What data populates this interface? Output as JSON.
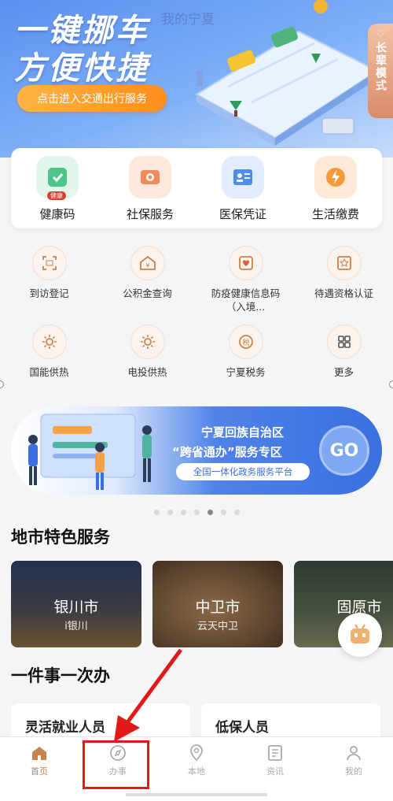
{
  "hero": {
    "title_line1": "一键挪车",
    "title_line2": "方便快捷",
    "watermark": "我的宁夏",
    "cta_label": "点击进入交通出行服务",
    "elder_mode_label": "长辈模式"
  },
  "main_services": [
    {
      "label": "健康码",
      "icon": "health-code-icon",
      "color": "#4cc48a",
      "badge": "健康"
    },
    {
      "label": "社保服务",
      "icon": "social-security-icon",
      "color": "#f08a5d"
    },
    {
      "label": "医保凭证",
      "icon": "medical-insurance-icon",
      "color": "#4b8ef0"
    },
    {
      "label": "生活缴费",
      "icon": "utility-payment-icon",
      "color": "#f59a3a"
    }
  ],
  "grid_services": [
    {
      "label": "到访登记",
      "icon": "scan-register-icon"
    },
    {
      "label": "公积金查询",
      "icon": "housing-fund-icon"
    },
    {
      "label": "防疫健康信息码（入境...",
      "icon": "epidemic-code-icon"
    },
    {
      "label": "待遇资格认证",
      "icon": "qualification-icon"
    },
    {
      "label": "国能供热",
      "icon": "heating-icon"
    },
    {
      "label": "电投供热",
      "icon": "heating-icon"
    },
    {
      "label": "宁夏税务",
      "icon": "tax-icon"
    },
    {
      "label": "更多",
      "icon": "more-grid-icon"
    }
  ],
  "promo": {
    "title_line1": "宁夏回族自治区",
    "title_line2": "“跨省通办”服务专区",
    "subtitle": "全国一体化政务服务平台",
    "go_label": "GO",
    "page_count": 7,
    "active_page": 5
  },
  "city_section": {
    "title": "地市特色服务",
    "cities": [
      {
        "name": "银川市",
        "sub": "i银川"
      },
      {
        "name": "中卫市",
        "sub": "云天中卫"
      },
      {
        "name": "固原市",
        "sub": ""
      }
    ]
  },
  "things_section": {
    "title": "一件事一次办",
    "items": [
      "灵活就业人员",
      "低保人员"
    ]
  },
  "tabbar": [
    {
      "label": "首页",
      "icon": "home-icon",
      "active": true
    },
    {
      "label": "办事",
      "icon": "compass-icon",
      "active": false
    },
    {
      "label": "本地",
      "icon": "location-icon",
      "active": false
    },
    {
      "label": "资讯",
      "icon": "news-icon",
      "active": false
    },
    {
      "label": "我的",
      "icon": "profile-icon",
      "active": false
    }
  ],
  "colors": {
    "accent": "#c9834a",
    "annotation": "#e01a1a",
    "hero_blue": "#5b8ff0"
  }
}
